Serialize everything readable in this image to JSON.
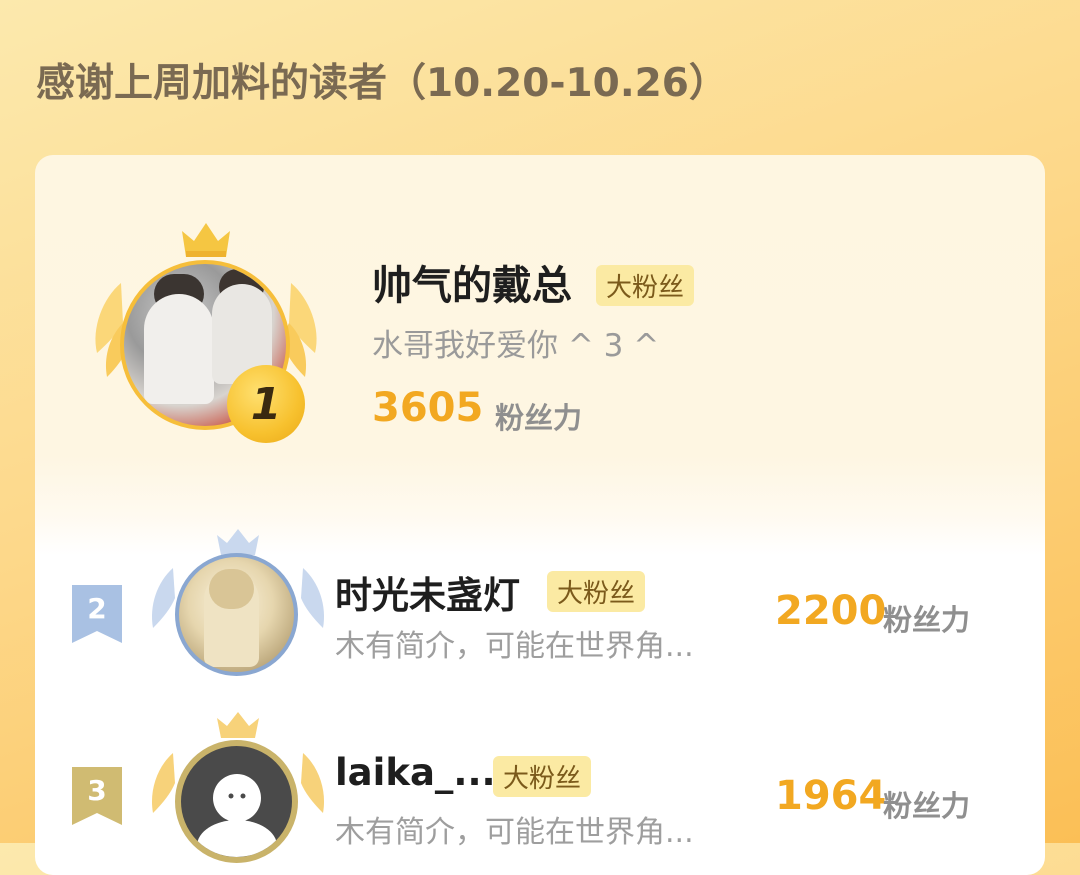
{
  "title": "感谢上周加料的读者（10.20-10.26）",
  "colors": {
    "gold": "#f2a821",
    "tag_bg": "#fbeaa3",
    "silver": "#8aa7d1",
    "bronze": "#c9b36a"
  },
  "readers": [
    {
      "rank": "1",
      "name": "帅气的戴总",
      "tag": "大粉丝",
      "bio": "水哥我好爱你 ^ 3 ^",
      "score": "3605",
      "unit": "粉丝力",
      "avatar": "photo-avatar"
    },
    {
      "rank": "2",
      "name": "时光未盏灯",
      "tag": "大粉丝",
      "bio": "木有简介，可能在世界角...",
      "score": "2200",
      "unit": "粉丝力",
      "avatar": "illustration-avatar"
    },
    {
      "rank": "3",
      "name": "laika_...",
      "tag": "大粉丝",
      "bio": "木有简介，可能在世界角...",
      "score": "1964",
      "unit": "粉丝力",
      "avatar": "default-avatar"
    }
  ]
}
